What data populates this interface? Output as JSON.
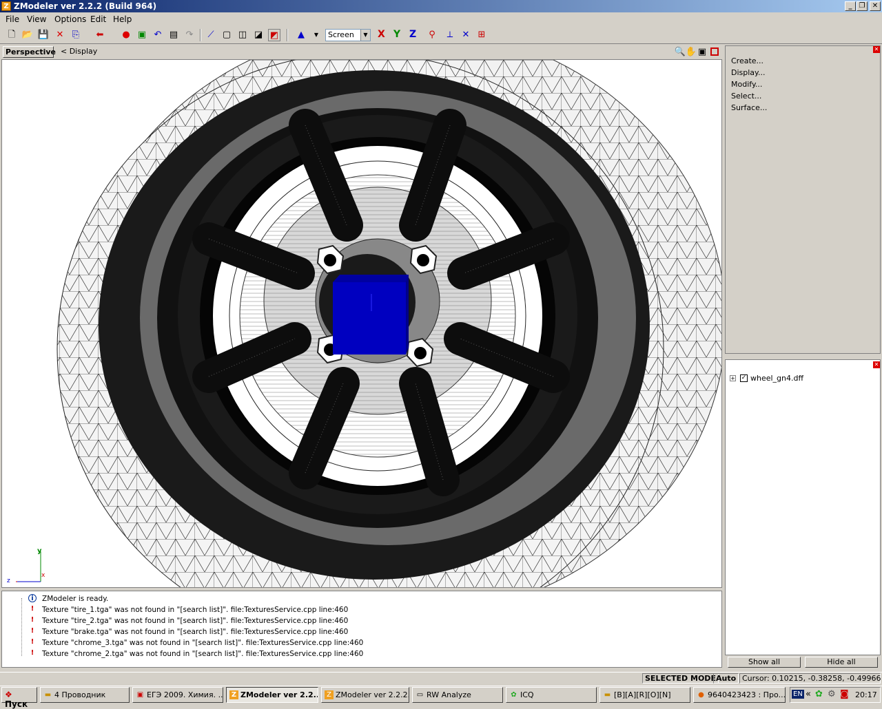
{
  "window": {
    "title": "ZModeler ver 2.2.2 (Build 964)",
    "app_icon": "Z"
  },
  "menu": [
    "File",
    "View",
    "Options",
    "Edit",
    "Help"
  ],
  "toolbar": {
    "view_mode": "Screen",
    "axes": [
      "X",
      "Y",
      "Z"
    ]
  },
  "viewport": {
    "tab": "Perspective",
    "breadcrumb": "<  Display",
    "axis_y": "y",
    "axis_z": "z",
    "axis_x": "x"
  },
  "commands": [
    "Create...",
    "Display...",
    "Modify...",
    "Select...",
    "Surface..."
  ],
  "tree": {
    "item": "wheel_gn4.dff",
    "expand": "+",
    "checked": "✓"
  },
  "panel_buttons": {
    "show_all": "Show all",
    "hide_all": "Hide all"
  },
  "log": [
    {
      "type": "info",
      "icon": "i",
      "text": "ZModeler is ready."
    },
    {
      "type": "error",
      "icon": "!",
      "text": "Texture \"tire_1.tga\" was not found in \"[search list]\". file:TexturesService.cpp line:460"
    },
    {
      "type": "error",
      "icon": "!",
      "text": "Texture \"tire_2.tga\" was not found in \"[search list]\". file:TexturesService.cpp line:460"
    },
    {
      "type": "error",
      "icon": "!",
      "text": "Texture \"brake.tga\" was not found in \"[search list]\". file:TexturesService.cpp line:460"
    },
    {
      "type": "error",
      "icon": "!",
      "text": "Texture \"chrome_3.tga\" was not found in \"[search list]\". file:TexturesService.cpp line:460"
    },
    {
      "type": "error",
      "icon": "!",
      "text": "Texture \"chrome_2.tga\" was not found in \"[search list]\". file:TexturesService.cpp line:460"
    }
  ],
  "status": {
    "mode": "SELECTED MODE",
    "snap": "Auto",
    "cursor": "Cursor: 0.10215, -0.38258, -0.49966"
  },
  "taskbar": {
    "start": "Пуск",
    "tasks": [
      {
        "label": "4 Проводник",
        "icon": "folder-icon"
      },
      {
        "label": "ЕГЭ 2009. Химия. ...",
        "icon": "pdf-icon"
      },
      {
        "label": "ZModeler ver 2.2...",
        "icon": "zmodeler-icon",
        "active": true
      },
      {
        "label": "ZModeler ver 2.2.2...",
        "icon": "zmodeler-icon"
      },
      {
        "label": "RW Analyze",
        "icon": "window-icon"
      },
      {
        "label": "ICQ",
        "icon": "icq-icon"
      },
      {
        "label": "[B][A][R][O][N]",
        "icon": "folder-icon"
      },
      {
        "label": "9640423423 : Про...",
        "icon": "firefox-icon"
      }
    ],
    "lang": "EN",
    "clock": "20:17",
    "tray_expand": "«"
  },
  "colors": {
    "titlebar_start": "#0a246a",
    "titlebar_end": "#a6caf0",
    "cube": "#0000c0",
    "error": "#cc0000",
    "info": "#003399"
  }
}
